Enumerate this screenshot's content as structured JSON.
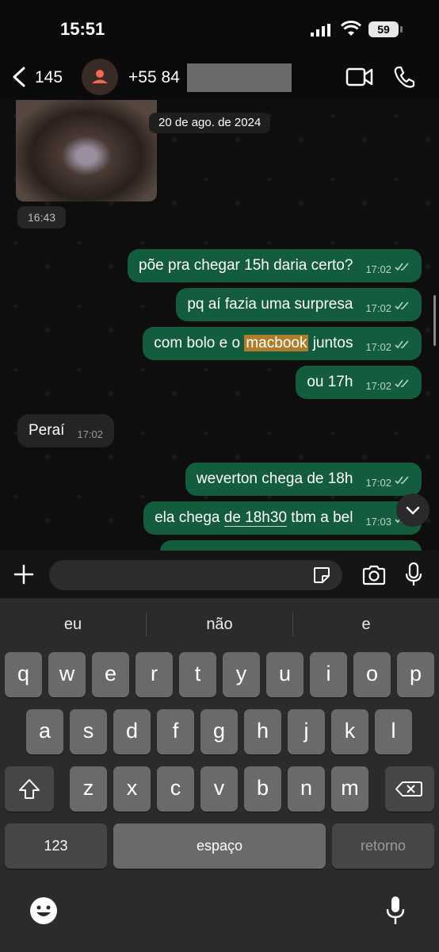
{
  "status": {
    "time": "15:51",
    "battery": "59"
  },
  "header": {
    "back_count": "145",
    "contact": "+55 84"
  },
  "chat": {
    "date": "20 de ago. de 2024",
    "photo_time": "16:43",
    "messages": [
      {
        "text": "põe pra chegar 15h daria certo?",
        "time": "17:02"
      },
      {
        "text": "pq aí fazia uma surpresa",
        "time": "17:02"
      },
      {
        "pre": "com bolo e o ",
        "highlight": "macbook",
        "post": " juntos",
        "time": "17:02"
      },
      {
        "text": "ou 17h",
        "time": "17:02"
      },
      {
        "text": "Peraí",
        "time": "17:02"
      },
      {
        "text": "weverton chega de 18h",
        "time": "17:02"
      },
      {
        "pre": "ela chega ",
        "underline": "de 18h30",
        "post": " tbm a bel",
        "time": "17:03"
      }
    ]
  },
  "keyboard": {
    "suggestions": [
      "eu",
      "não",
      "e"
    ],
    "row1": [
      "q",
      "w",
      "e",
      "r",
      "t",
      "y",
      "u",
      "i",
      "o",
      "p"
    ],
    "row2": [
      "a",
      "s",
      "d",
      "f",
      "g",
      "h",
      "j",
      "k",
      "l"
    ],
    "row3": [
      "z",
      "x",
      "c",
      "v",
      "b",
      "n",
      "m"
    ],
    "numbers": "123",
    "space": "espaço",
    "return": "retorno"
  },
  "colors": {
    "outgoing_bubble": "#135c3d",
    "incoming_bubble": "#242424",
    "highlight": "#b07d2c"
  }
}
